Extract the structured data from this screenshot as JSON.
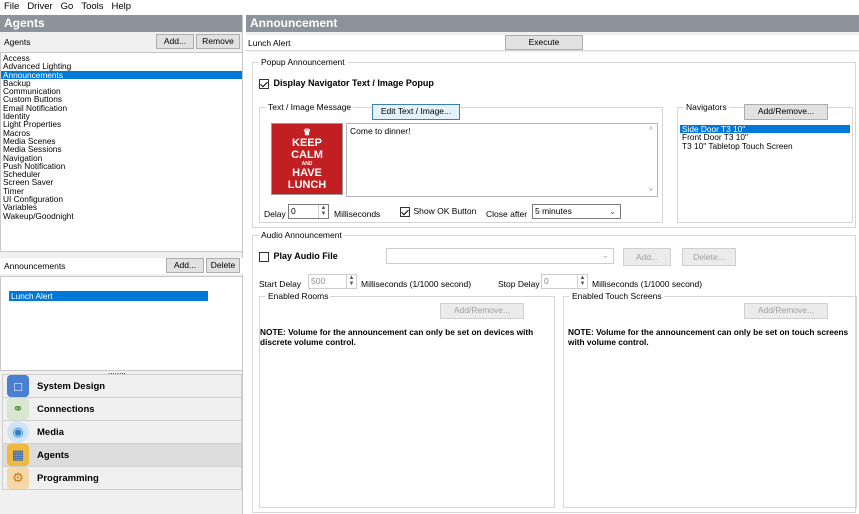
{
  "menu": [
    "File",
    "Driver",
    "Go",
    "Tools",
    "Help"
  ],
  "left": {
    "header": "Agents",
    "agents_label": "Agents",
    "add_label": "Add...",
    "remove_label": "Remove",
    "agents": [
      "Access",
      "Advanced Lighting",
      "Announcements",
      "Backup",
      "Communication",
      "Custom Buttons",
      "Email Notification",
      "Identity",
      "Light Properties",
      "Macros",
      "Media Scenes",
      "Media Sessions",
      "Navigation",
      "Push Notification",
      "Scheduler",
      "Screen Saver",
      "Timer",
      "UI Configuration",
      "Variables",
      "Wakeup/Goodnight"
    ],
    "selected_agent": "Announcements",
    "announcements_label": "Announcements",
    "ann_add_label": "Add...",
    "ann_delete_label": "Delete",
    "announcements": [
      "Lunch Alert"
    ],
    "splitter_dots": "........",
    "nav": [
      {
        "label": "System Design",
        "icon": "system-design-icon"
      },
      {
        "label": "Connections",
        "icon": "connections-icon"
      },
      {
        "label": "Media",
        "icon": "media-icon"
      },
      {
        "label": "Agents",
        "icon": "agents-icon"
      },
      {
        "label": "Programming",
        "icon": "programming-icon"
      }
    ]
  },
  "right": {
    "header": "Announcement",
    "announcement_name": "Lunch Alert",
    "execute_label": "Execute",
    "popup": {
      "group_title": "Popup Announcement",
      "display_label": "Display Navigator Text / Image Popup",
      "display_checked": true,
      "text_group_title": "Text / Image Message",
      "edit_label": "Edit Text / Image...",
      "message": "Come to dinner!",
      "image_lines": [
        "KEEP",
        "CALM",
        "AND",
        "HAVE",
        "LUNCH"
      ],
      "delay_label": "Delay",
      "delay_value": "0",
      "ms_label": "Milliseconds",
      "show_ok_label": "Show OK Button",
      "show_ok_checked": true,
      "close_after_label": "Close after",
      "close_after_value": "5 minutes",
      "navigators_title": "Navigators",
      "navigators_add_label": "Add/Remove...",
      "navigators": [
        "Side Door T3 10\"",
        "Front Door T3 10\"",
        "T3 10\" Tabletop Touch Screen"
      ]
    },
    "audio": {
      "group_title": "Audio Announcement",
      "play_label": "Play Audio File",
      "play_checked": false,
      "add_label": "Add...",
      "delete_label": "Delete...",
      "start_delay_label": "Start Delay",
      "start_delay_value": "500",
      "start_ms_label": "Milliseconds (1/1000 second)",
      "stop_delay_label": "Stop Delay",
      "stop_delay_value": "0",
      "stop_ms_label": "Milliseconds (1/1000 second)",
      "rooms_title": "Enabled Rooms",
      "rooms_add_label": "Add/Remove...",
      "rooms_note": "NOTE: Volume for the announcement can only be set on devices with discrete volume control.",
      "screens_title": "Enabled Touch Screens",
      "screens_add_label": "Add/Remove...",
      "screens_note": "NOTE: Volume for the announcement can only be set on touch screens with volume control."
    }
  }
}
